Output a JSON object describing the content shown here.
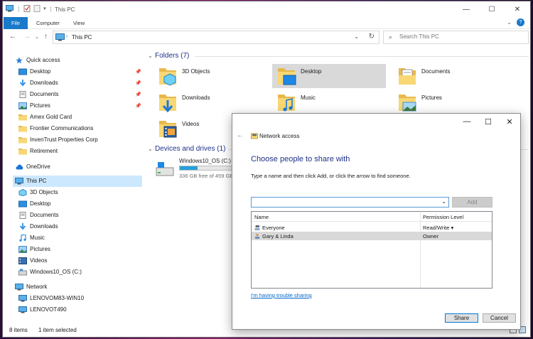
{
  "window": {
    "title": "This PC",
    "controls": [
      "minimize",
      "maximize",
      "close"
    ]
  },
  "ribbon": {
    "tabs": [
      "File",
      "Computer",
      "View"
    ],
    "help_label": "?"
  },
  "address": {
    "crumb": "This PC",
    "search_placeholder": "Search This PC"
  },
  "nav": {
    "quick_access": "Quick access",
    "quick_items": [
      {
        "label": "Desktop",
        "icon": "desktop-icon",
        "pinned": true
      },
      {
        "label": "Downloads",
        "icon": "downloads-icon",
        "pinned": true
      },
      {
        "label": "Documents",
        "icon": "documents-icon",
        "pinned": true
      },
      {
        "label": "Pictures",
        "icon": "pictures-icon",
        "pinned": true
      },
      {
        "label": "Amex Gold Card",
        "icon": "folder-icon",
        "pinned": false
      },
      {
        "label": "Frontier Communications",
        "icon": "folder-icon",
        "pinned": false
      },
      {
        "label": "InvenTrust Properties Corp",
        "icon": "folder-icon",
        "pinned": false
      },
      {
        "label": "Retirement",
        "icon": "folder-icon",
        "pinned": false
      }
    ],
    "onedrive": "OneDrive",
    "this_pc": "This PC",
    "pc_items": [
      {
        "label": "3D Objects",
        "icon": "3d-objects-icon"
      },
      {
        "label": "Desktop",
        "icon": "desktop-icon"
      },
      {
        "label": "Documents",
        "icon": "documents-icon"
      },
      {
        "label": "Downloads",
        "icon": "downloads-icon"
      },
      {
        "label": "Music",
        "icon": "music-icon"
      },
      {
        "label": "Pictures",
        "icon": "pictures-icon"
      },
      {
        "label": "Videos",
        "icon": "videos-icon"
      },
      {
        "label": "Windows10_OS (C:)",
        "icon": "drive-icon"
      }
    ],
    "network": "Network",
    "network_items": [
      {
        "label": "LENOVOM83-WIN10",
        "icon": "computer-icon"
      },
      {
        "label": "LENOVOT490",
        "icon": "computer-icon"
      }
    ]
  },
  "main": {
    "folders_header": "Folders (7)",
    "folders": [
      {
        "label": "3D Objects",
        "icon": "3d-objects-icon",
        "selected": false
      },
      {
        "label": "Desktop",
        "icon": "desktop-icon",
        "selected": true
      },
      {
        "label": "Documents",
        "icon": "documents-icon",
        "selected": false
      },
      {
        "label": "Downloads",
        "icon": "downloads-icon",
        "selected": false
      },
      {
        "label": "Music",
        "icon": "music-icon",
        "selected": false
      },
      {
        "label": "Pictures",
        "icon": "pictures-icon",
        "selected": false
      },
      {
        "label": "Videos",
        "icon": "videos-icon",
        "selected": false
      }
    ],
    "drives_header": "Devices and drives (1)",
    "drive": {
      "label": "Windows10_OS (C:)",
      "free_text": "336 GB free of 459 GB",
      "used_fraction": 0.27
    }
  },
  "status": {
    "items": "8 items",
    "selected": "1 item selected"
  },
  "dialog": {
    "title": "Network access",
    "heading": "Choose people to share with",
    "instruction": "Type a name and then click Add, or click the arrow to find someone.",
    "input_value": "",
    "add_label": "Add",
    "columns": [
      "Name",
      "Permission Level"
    ],
    "rows": [
      {
        "name": "Everyone",
        "permission": "Read/Write ▾",
        "selected": false
      },
      {
        "name": "Gary & Linda",
        "permission": "Owner",
        "selected": true
      }
    ],
    "trouble_link": "I'm having trouble sharing",
    "share_label": "Share",
    "cancel_label": "Cancel"
  },
  "colors": {
    "accent": "#1979ca",
    "heading_blue": "#1e3287",
    "selection": "#cce8ff",
    "drive_bar": "#26a0da"
  }
}
